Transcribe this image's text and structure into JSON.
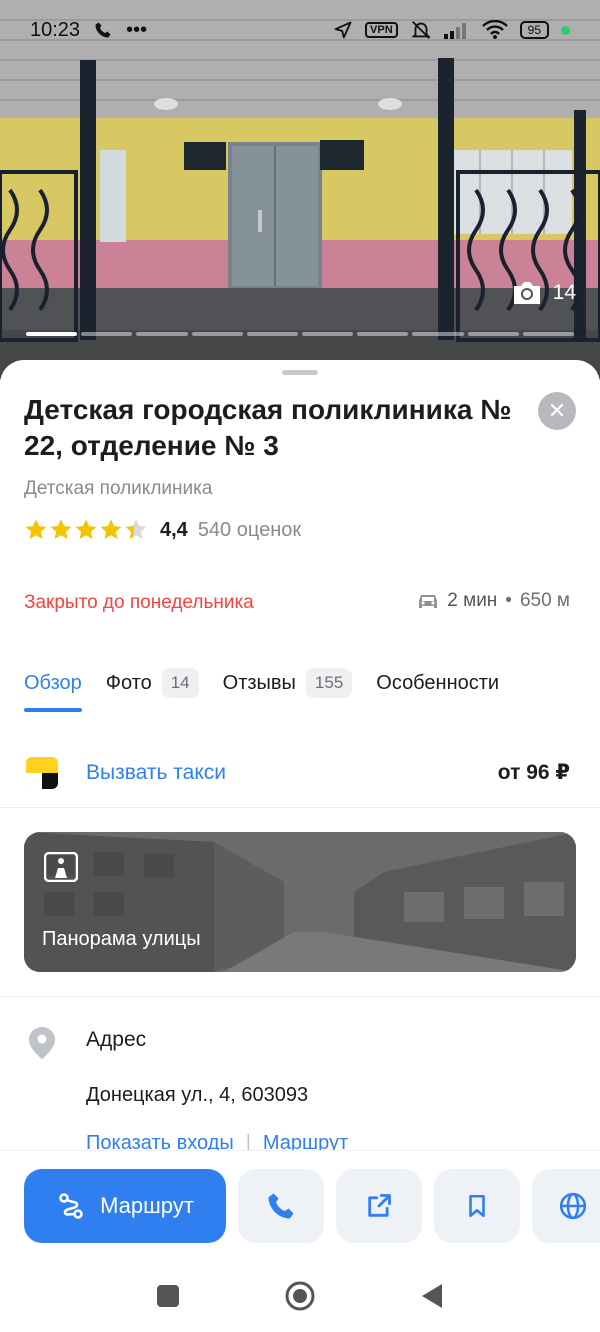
{
  "status_bar": {
    "time": "10:23",
    "vpn": "VPN",
    "battery": "95"
  },
  "hero": {
    "photo_count": "14"
  },
  "place": {
    "title": "Детская городская поликлиника № 22, отделение № 3",
    "category": "Детская поликлиника",
    "rating_value": "4,4",
    "rating_stars": 4.4,
    "rating_count": "540 оценок",
    "status": "Закрыто до понедельника",
    "travel_time": "2 мин",
    "travel_sep": "•",
    "travel_distance": "650 м",
    "status_color": "#f2453d"
  },
  "tabs": [
    {
      "label": "Обзор",
      "count": ""
    },
    {
      "label": "Фото",
      "count": "14"
    },
    {
      "label": "Отзывы",
      "count": "155"
    },
    {
      "label": "Особенности",
      "count": ""
    }
  ],
  "taxi": {
    "label": "Вызвать такси",
    "price": "от 96 ₽"
  },
  "panorama": {
    "label": "Панорама улицы"
  },
  "address": {
    "title": "Адрес",
    "value": "Донецкая ул., 4, 603093",
    "link_entrances": "Показать входы",
    "link_separator": "|",
    "link_route": "Маршрут"
  },
  "actions": {
    "route_label": "Маршрут"
  },
  "colors": {
    "accent": "#2f7ff0"
  }
}
